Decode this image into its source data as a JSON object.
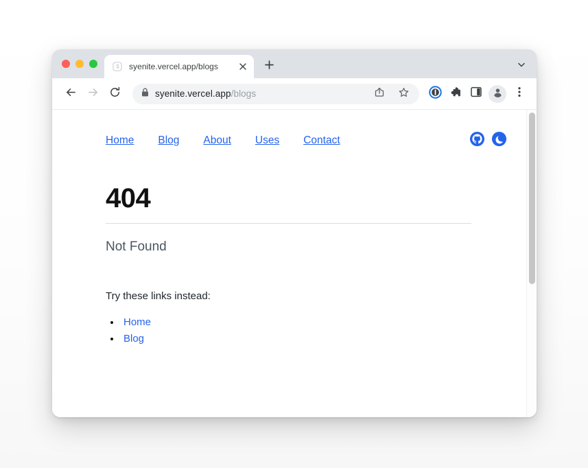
{
  "window": {
    "traffic_lights": [
      {
        "name": "close",
        "color": "#ff5f57"
      },
      {
        "name": "minimize",
        "color": "#febc2e"
      },
      {
        "name": "maximize",
        "color": "#28c840"
      }
    ]
  },
  "browser": {
    "tab": {
      "title": "syenite.vercel.app/blogs",
      "favicon": "syenite-logo-icon",
      "close_icon": "close-icon"
    },
    "new_tab_icon": "plus-icon",
    "tab_search_icon": "chevron-down-icon",
    "toolbar": {
      "back_icon": "back-arrow-icon",
      "forward_icon": "forward-arrow-icon",
      "reload_icon": "reload-icon",
      "lock_icon": "lock-icon",
      "url_host": "syenite.vercel.app",
      "url_path": "/blogs",
      "url_full": "syenite.vercel.app/blogs",
      "share_icon": "share-icon",
      "bookmark_icon": "star-icon",
      "onepassword_icon": "onepassword-extension-icon",
      "extensions_icon": "puzzle-piece-icon",
      "side_panel_icon": "side-panel-icon",
      "profile_icon": "profile-avatar-icon",
      "menu_icon": "three-dot-menu-icon"
    },
    "scrollbar": {
      "present": true
    }
  },
  "site": {
    "nav": {
      "links": [
        {
          "label": "Home"
        },
        {
          "label": "Blog"
        },
        {
          "label": "About"
        },
        {
          "label": "Uses"
        },
        {
          "label": "Contact"
        }
      ],
      "icons": [
        {
          "name": "github-icon",
          "color": "#2563eb"
        },
        {
          "name": "dark-mode-moon-icon",
          "color": "#2563eb"
        }
      ]
    },
    "content": {
      "error_code": "404",
      "error_message": "Not Found",
      "suggestion_text": "Try these links instead:",
      "suggestion_links": [
        {
          "label": "Home"
        },
        {
          "label": "Blog"
        }
      ]
    },
    "colors": {
      "link": "#2563eb",
      "heading": "#111111",
      "muted": "#4b5563"
    }
  }
}
